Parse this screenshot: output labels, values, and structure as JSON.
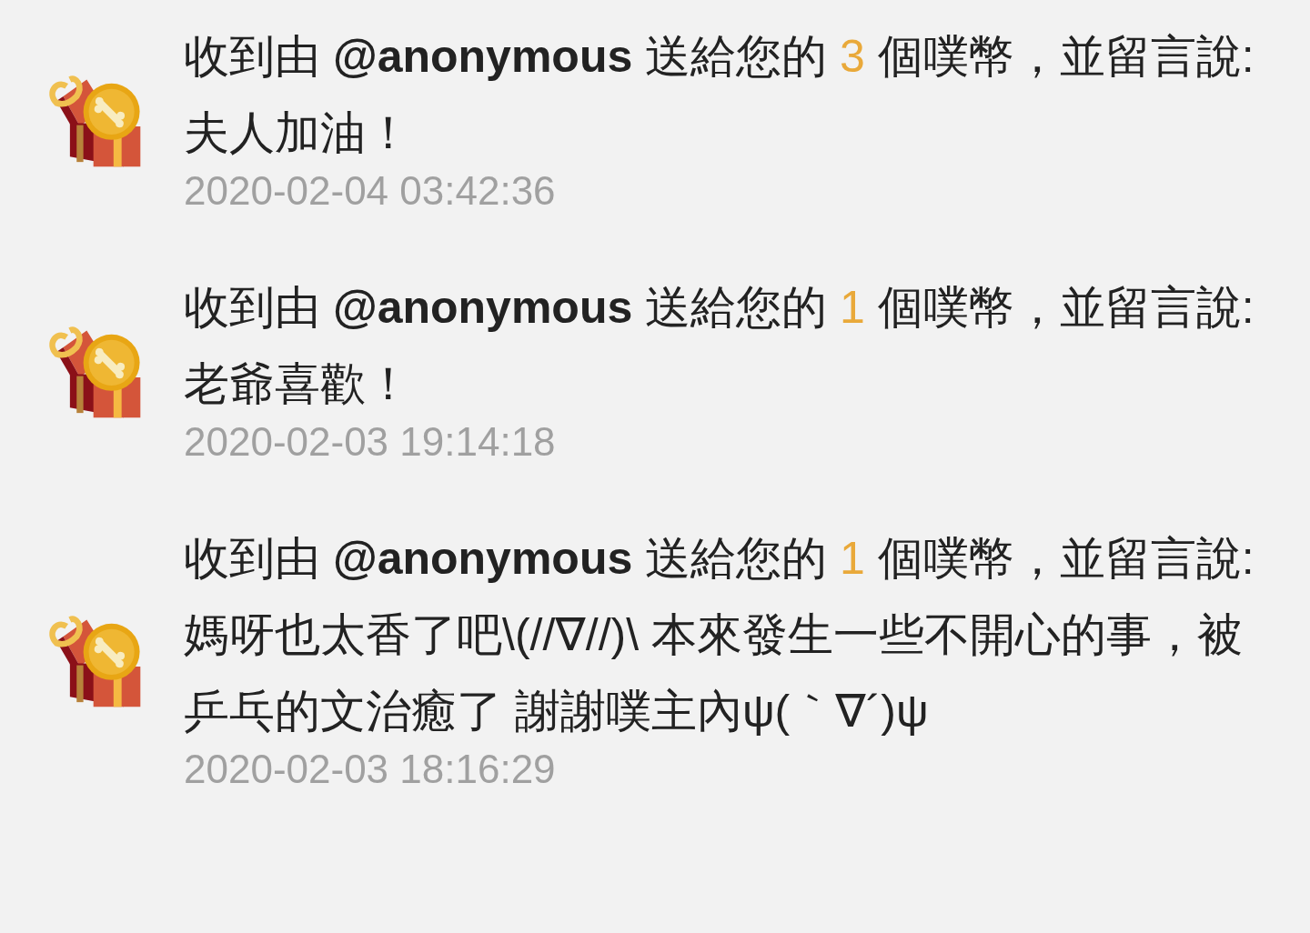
{
  "notifications": [
    {
      "prefix": "收到由",
      "sender": "@anonymous",
      "mid": "送給您的",
      "count": "3",
      "suffix": "個噗幣，並留言說:",
      "message": "夫人加油！",
      "time": "2020-02-04 03:42:36"
    },
    {
      "prefix": "收到由",
      "sender": "@anonymous",
      "mid": "送給您的",
      "count": "1",
      "suffix": "個噗幣，並留言說:",
      "message": "老爺喜歡！",
      "time": "2020-02-03 19:14:18"
    },
    {
      "prefix": "收到由",
      "sender": "@anonymous",
      "mid": "送給您的",
      "count": "1",
      "suffix": "個噗幣，並留言說:",
      "message": "媽呀也太香了吧\\(//∇//)\\ 本來發生一些不開心的事，被乒乓的文治癒了 謝謝噗主內ψ(｀∇´)ψ",
      "time": "2020-02-03 18:16:29"
    }
  ]
}
